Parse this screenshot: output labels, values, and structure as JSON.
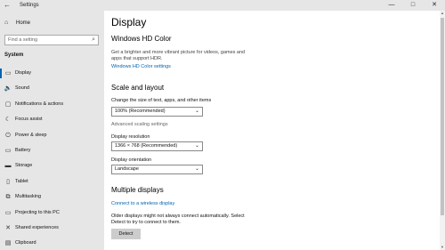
{
  "window": {
    "title": "Settings",
    "back_icon": "←",
    "minimize": "—",
    "maximize": "□",
    "close": "✕"
  },
  "sidebar": {
    "home_label": "Home",
    "home_icon": "⌂",
    "search_placeholder": "Find a setting",
    "search_icon": "⌕",
    "section_title": "System",
    "items": [
      {
        "label": "Display",
        "icon": "▭",
        "active": true
      },
      {
        "label": "Sound",
        "icon": "🔈"
      },
      {
        "label": "Notifications & actions",
        "icon": "▢"
      },
      {
        "label": "Focus assist",
        "icon": "☾"
      },
      {
        "label": "Power & sleep",
        "icon": "⏻"
      },
      {
        "label": "Battery",
        "icon": "▭"
      },
      {
        "label": "Storage",
        "icon": "▬"
      },
      {
        "label": "Tablet",
        "icon": "▯"
      },
      {
        "label": "Multitasking",
        "icon": "⧉"
      },
      {
        "label": "Projecting to this PC",
        "icon": "▭"
      },
      {
        "label": "Shared experiences",
        "icon": "✕"
      },
      {
        "label": "Clipboard",
        "icon": "▤"
      }
    ]
  },
  "main": {
    "title": "Display",
    "hdr": {
      "heading": "Windows HD Color",
      "description": "Get a brighter and more vibrant picture for videos, games and apps that support HDR.",
      "link": "Windows HD Color settings"
    },
    "scale": {
      "heading": "Scale and layout",
      "size_label": "Change the size of text, apps, and other items",
      "size_value": "100% (Recommended)",
      "advanced_link": "Advanced scaling settings",
      "resolution_label": "Display resolution",
      "resolution_value": "1366 × 768 (Recommended)",
      "orientation_label": "Display orientation",
      "orientation_value": "Landscape"
    },
    "multiple": {
      "heading": "Multiple displays",
      "wireless_link": "Connect to a wireless display",
      "description": "Older displays might not always connect automatically. Select Detect to try to connect to them.",
      "detect_label": "Detect"
    }
  },
  "colors": {
    "accent": "#0063b1",
    "sidebar_bg": "#e6e6e6"
  }
}
